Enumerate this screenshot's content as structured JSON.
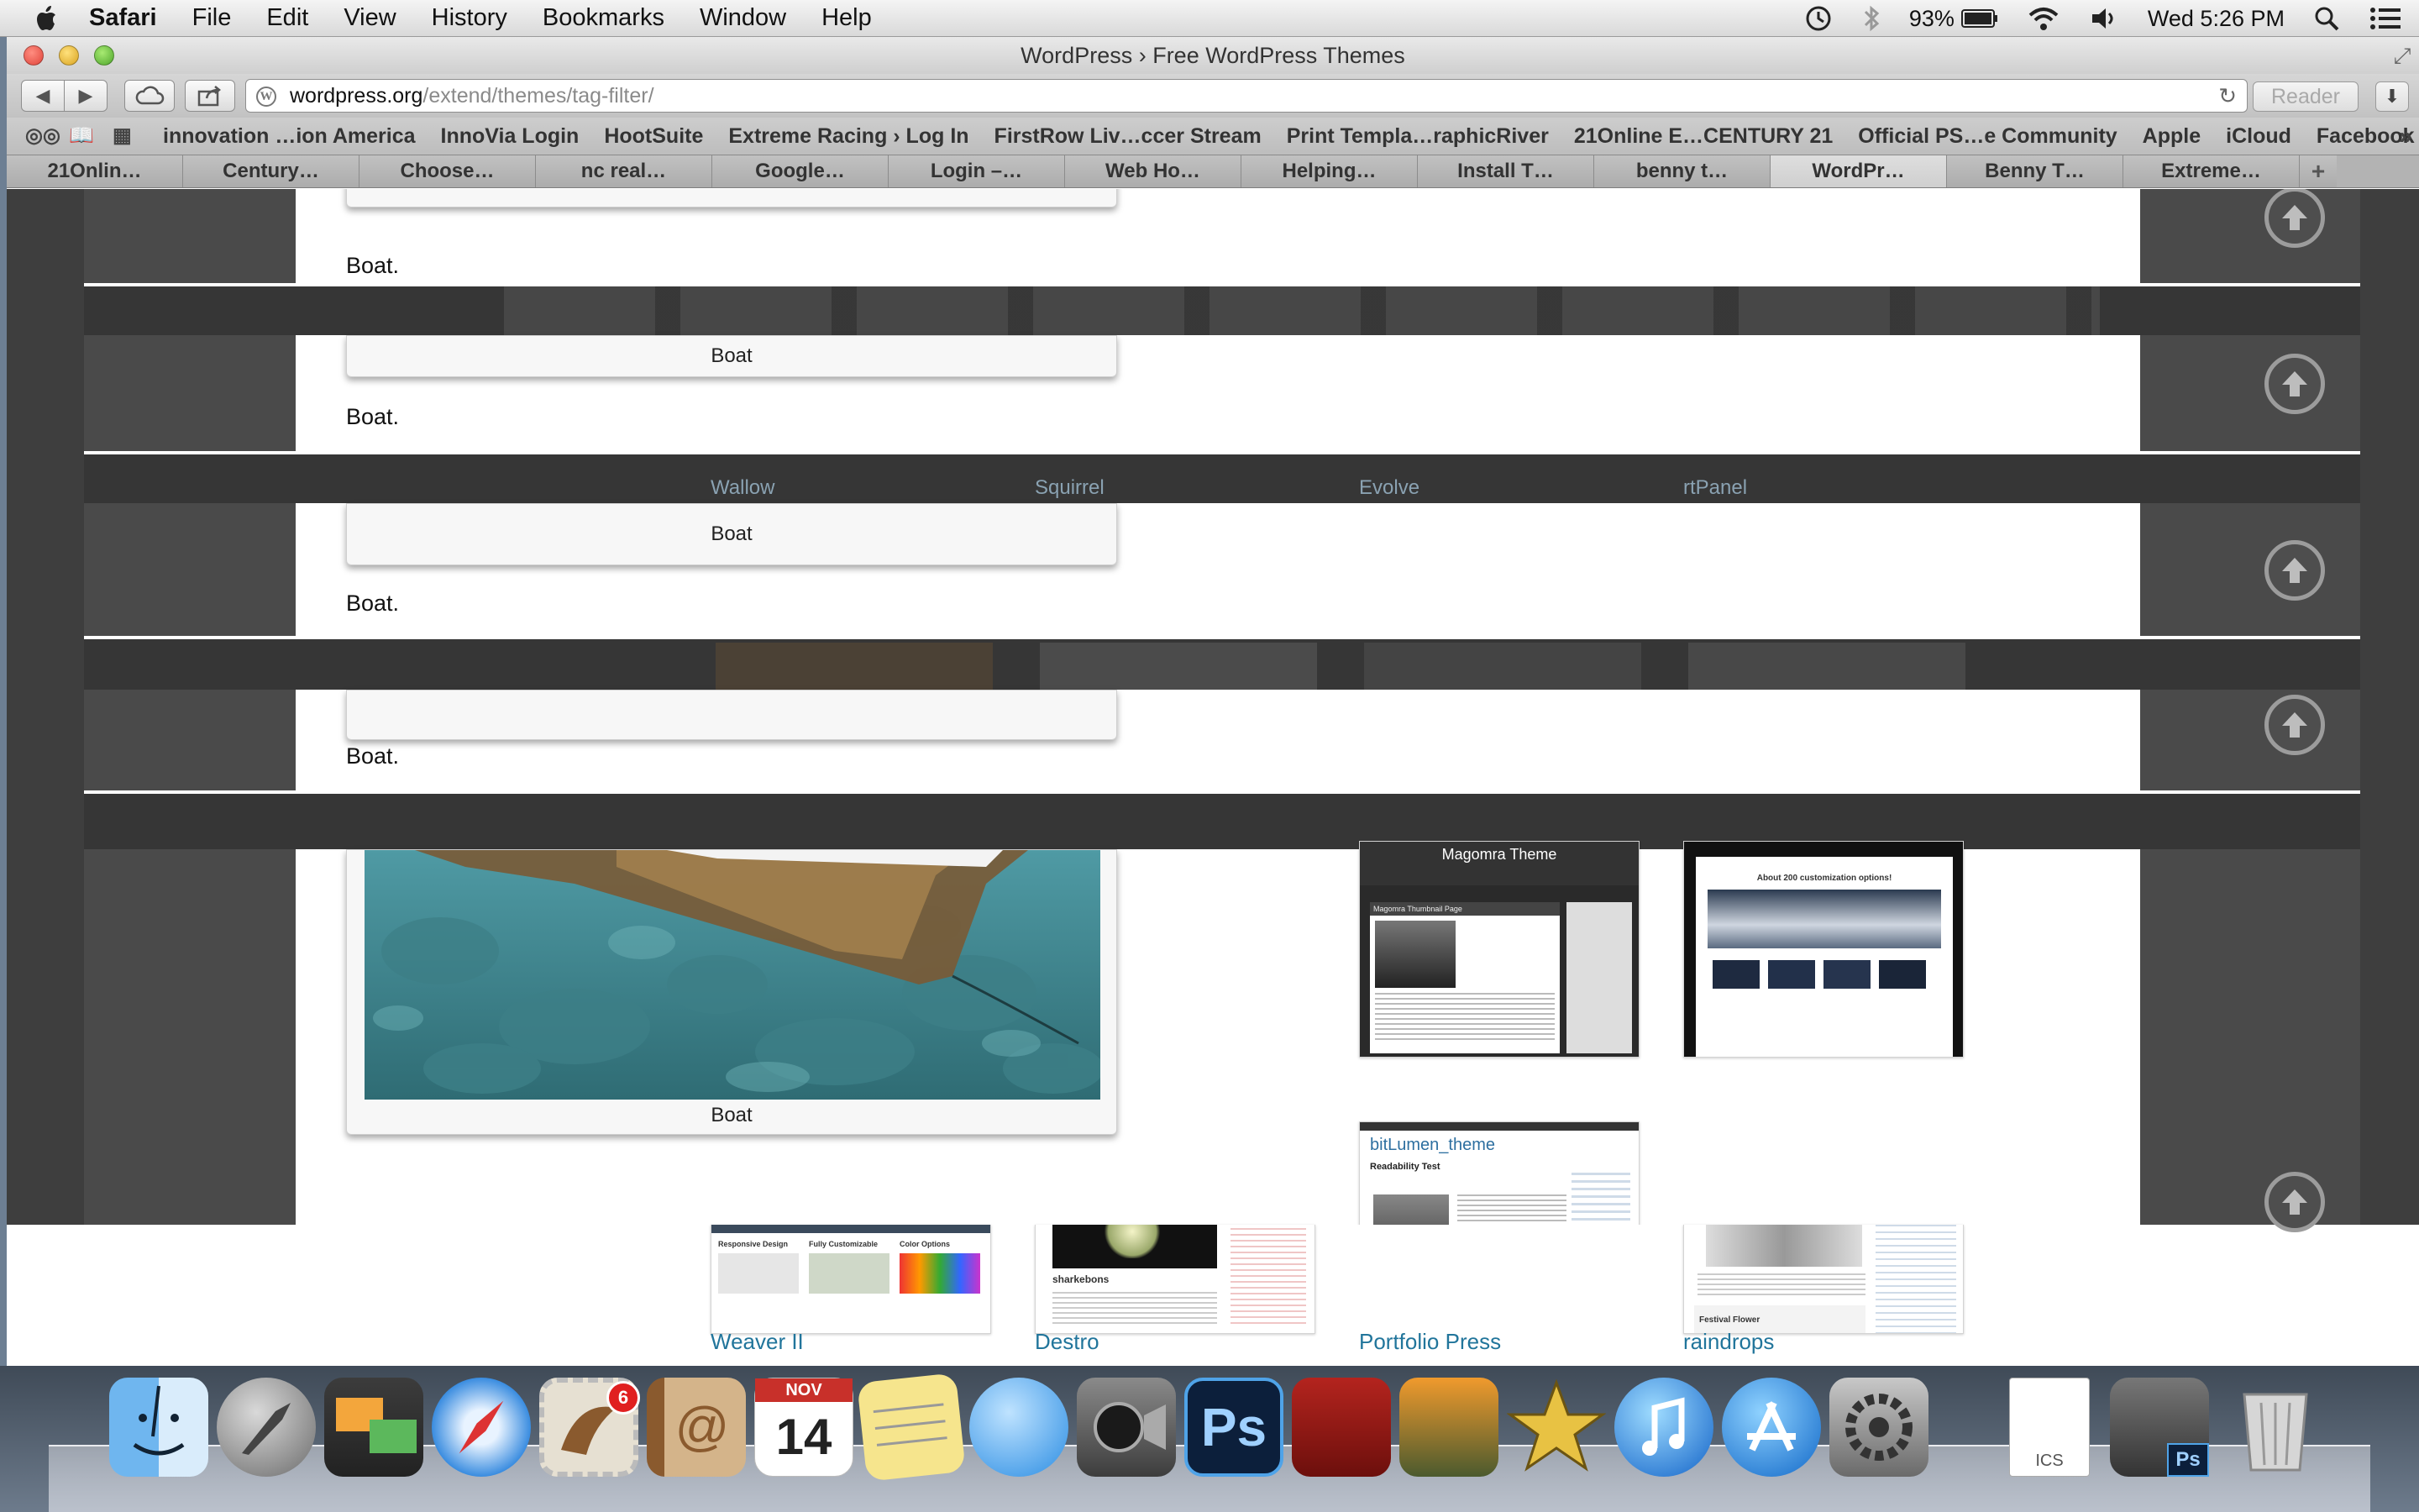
{
  "menubar": {
    "app": "Safari",
    "items": [
      "File",
      "Edit",
      "View",
      "History",
      "Bookmarks",
      "Window",
      "Help"
    ],
    "battery": "93%",
    "clock": "Wed 5:26 PM"
  },
  "window": {
    "title": "WordPress › Free WordPress Themes",
    "url_host": "wordpress.org",
    "url_path": "/extend/themes/tag-filter/",
    "reader_label": "Reader"
  },
  "bookmarks": [
    "innovation …ion America",
    "InnoVia Login",
    "HootSuite",
    "Extreme Racing › Log In",
    "FirstRow Liv…ccer Stream",
    "Print Templa…raphicRiver",
    "21Online E…CENTURY 21",
    "Official PS…e Community",
    "Apple",
    "iCloud",
    "Facebook"
  ],
  "tabs": [
    "21Onlin…",
    "Century…",
    "Choose…",
    "nc real…",
    "Google…",
    "Login –…",
    "Web Ho…",
    "Helping…",
    "Install T…",
    "benny t…",
    "WordPr…",
    "Benny T…",
    "Extreme…"
  ],
  "active_tab_index": 10,
  "lightbox": {
    "caption": "Boat",
    "description": "Boat."
  },
  "themes_row1": [
    "Wallow",
    "Squirrel",
    "Evolve",
    "rtPanel"
  ],
  "themes_row2": [
    "Weaver II",
    "Destro",
    "Portfolio Press",
    "raindrops"
  ],
  "theme_previews": {
    "magomra_title": "Magomra Theme",
    "magomra_page": "Magomra Thumbnail Page",
    "minimo_tagline": "About 200 customization options!",
    "bitlumen_title": "bitLumen_theme",
    "bitlumen_post": "Readability Test",
    "weaver_col1": "Responsive Design",
    "weaver_col2": "Fully Customizable",
    "weaver_col3": "Color Options",
    "destro_post": "sharkebons",
    "raindrops_post": "Festival Flower"
  },
  "dock": {
    "mail_badge": "6",
    "calendar_month": "NOV",
    "calendar_day": "14",
    "ics_label": "ICS",
    "ps_label": "Ps"
  },
  "colors": {
    "link": "#21759b",
    "lightbox_backdrop": "#3a3a3a"
  }
}
